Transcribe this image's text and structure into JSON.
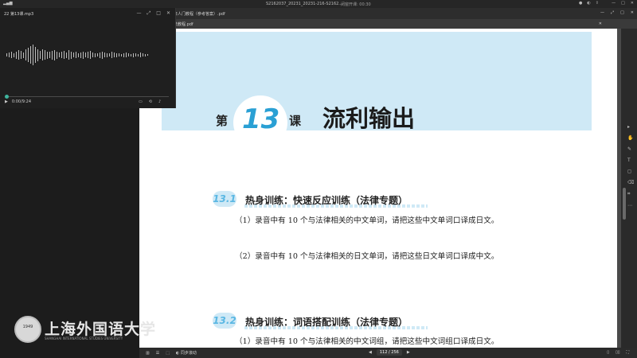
{
  "system_bar": {
    "window_title": "S2162037_20231_20231-216-S2162...",
    "timer": "闭窗开课: 00:30"
  },
  "audio_player": {
    "file_name": "22 第13课.mp3",
    "time": "0:00/9:24",
    "progress": 0.0
  },
  "pdf_window": {
    "title": "日人门教程（参考答案）.pdf",
    "sub_title": "法教程.pdf"
  },
  "page": {
    "lesson_prefix": "第",
    "lesson_number": "13",
    "lesson_suffix": "课",
    "lesson_title": "流利输出",
    "sections": [
      {
        "num": "13.1",
        "title": "热身训练：快速反应训练（法律专题）",
        "lines": [
          "（1）录音中有 10 个与法律相关的中文单词，请把这些中文单词口译成日文。",
          "（2）录音中有 10 个与法律相关的日文单词，请把这些日文单词口译成中文。"
        ]
      },
      {
        "num": "13.2",
        "title": "热身训练：词语搭配训练（法律专题）",
        "lines": [
          "（1）录音中有 10 个与法律相关的中文词组，请把这些中文词组口译成日文。"
        ]
      }
    ]
  },
  "status_bar": {
    "sync_label": "同步滚动",
    "page_indicator": "112 / 256"
  },
  "watermark": {
    "name_cn": "上海外国语大学",
    "name_en": "SHANGHAI INTERNATIONAL STUDIES UNIVERSITY",
    "year": "1949"
  },
  "colors": {
    "band": "#cfe9f6",
    "accent": "#2aa0d4",
    "player_knob": "#3fb59e"
  }
}
